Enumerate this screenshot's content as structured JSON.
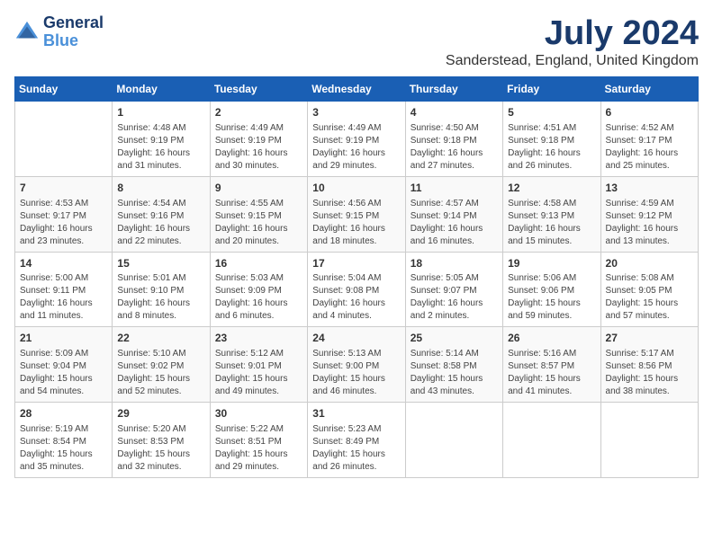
{
  "header": {
    "logo_line1": "General",
    "logo_line2": "Blue",
    "title": "July 2024",
    "subtitle": "Sanderstead, England, United Kingdom"
  },
  "calendar": {
    "headers": [
      "Sunday",
      "Monday",
      "Tuesday",
      "Wednesday",
      "Thursday",
      "Friday",
      "Saturday"
    ],
    "weeks": [
      [
        {
          "day": "",
          "sunrise": "",
          "sunset": "",
          "daylight": ""
        },
        {
          "day": "1",
          "sunrise": "Sunrise: 4:48 AM",
          "sunset": "Sunset: 9:19 PM",
          "daylight": "Daylight: 16 hours and 31 minutes."
        },
        {
          "day": "2",
          "sunrise": "Sunrise: 4:49 AM",
          "sunset": "Sunset: 9:19 PM",
          "daylight": "Daylight: 16 hours and 30 minutes."
        },
        {
          "day": "3",
          "sunrise": "Sunrise: 4:49 AM",
          "sunset": "Sunset: 9:19 PM",
          "daylight": "Daylight: 16 hours and 29 minutes."
        },
        {
          "day": "4",
          "sunrise": "Sunrise: 4:50 AM",
          "sunset": "Sunset: 9:18 PM",
          "daylight": "Daylight: 16 hours and 27 minutes."
        },
        {
          "day": "5",
          "sunrise": "Sunrise: 4:51 AM",
          "sunset": "Sunset: 9:18 PM",
          "daylight": "Daylight: 16 hours and 26 minutes."
        },
        {
          "day": "6",
          "sunrise": "Sunrise: 4:52 AM",
          "sunset": "Sunset: 9:17 PM",
          "daylight": "Daylight: 16 hours and 25 minutes."
        }
      ],
      [
        {
          "day": "7",
          "sunrise": "Sunrise: 4:53 AM",
          "sunset": "Sunset: 9:17 PM",
          "daylight": "Daylight: 16 hours and 23 minutes."
        },
        {
          "day": "8",
          "sunrise": "Sunrise: 4:54 AM",
          "sunset": "Sunset: 9:16 PM",
          "daylight": "Daylight: 16 hours and 22 minutes."
        },
        {
          "day": "9",
          "sunrise": "Sunrise: 4:55 AM",
          "sunset": "Sunset: 9:15 PM",
          "daylight": "Daylight: 16 hours and 20 minutes."
        },
        {
          "day": "10",
          "sunrise": "Sunrise: 4:56 AM",
          "sunset": "Sunset: 9:15 PM",
          "daylight": "Daylight: 16 hours and 18 minutes."
        },
        {
          "day": "11",
          "sunrise": "Sunrise: 4:57 AM",
          "sunset": "Sunset: 9:14 PM",
          "daylight": "Daylight: 16 hours and 16 minutes."
        },
        {
          "day": "12",
          "sunrise": "Sunrise: 4:58 AM",
          "sunset": "Sunset: 9:13 PM",
          "daylight": "Daylight: 16 hours and 15 minutes."
        },
        {
          "day": "13",
          "sunrise": "Sunrise: 4:59 AM",
          "sunset": "Sunset: 9:12 PM",
          "daylight": "Daylight: 16 hours and 13 minutes."
        }
      ],
      [
        {
          "day": "14",
          "sunrise": "Sunrise: 5:00 AM",
          "sunset": "Sunset: 9:11 PM",
          "daylight": "Daylight: 16 hours and 11 minutes."
        },
        {
          "day": "15",
          "sunrise": "Sunrise: 5:01 AM",
          "sunset": "Sunset: 9:10 PM",
          "daylight": "Daylight: 16 hours and 8 minutes."
        },
        {
          "day": "16",
          "sunrise": "Sunrise: 5:03 AM",
          "sunset": "Sunset: 9:09 PM",
          "daylight": "Daylight: 16 hours and 6 minutes."
        },
        {
          "day": "17",
          "sunrise": "Sunrise: 5:04 AM",
          "sunset": "Sunset: 9:08 PM",
          "daylight": "Daylight: 16 hours and 4 minutes."
        },
        {
          "day": "18",
          "sunrise": "Sunrise: 5:05 AM",
          "sunset": "Sunset: 9:07 PM",
          "daylight": "Daylight: 16 hours and 2 minutes."
        },
        {
          "day": "19",
          "sunrise": "Sunrise: 5:06 AM",
          "sunset": "Sunset: 9:06 PM",
          "daylight": "Daylight: 15 hours and 59 minutes."
        },
        {
          "day": "20",
          "sunrise": "Sunrise: 5:08 AM",
          "sunset": "Sunset: 9:05 PM",
          "daylight": "Daylight: 15 hours and 57 minutes."
        }
      ],
      [
        {
          "day": "21",
          "sunrise": "Sunrise: 5:09 AM",
          "sunset": "Sunset: 9:04 PM",
          "daylight": "Daylight: 15 hours and 54 minutes."
        },
        {
          "day": "22",
          "sunrise": "Sunrise: 5:10 AM",
          "sunset": "Sunset: 9:02 PM",
          "daylight": "Daylight: 15 hours and 52 minutes."
        },
        {
          "day": "23",
          "sunrise": "Sunrise: 5:12 AM",
          "sunset": "Sunset: 9:01 PM",
          "daylight": "Daylight: 15 hours and 49 minutes."
        },
        {
          "day": "24",
          "sunrise": "Sunrise: 5:13 AM",
          "sunset": "Sunset: 9:00 PM",
          "daylight": "Daylight: 15 hours and 46 minutes."
        },
        {
          "day": "25",
          "sunrise": "Sunrise: 5:14 AM",
          "sunset": "Sunset: 8:58 PM",
          "daylight": "Daylight: 15 hours and 43 minutes."
        },
        {
          "day": "26",
          "sunrise": "Sunrise: 5:16 AM",
          "sunset": "Sunset: 8:57 PM",
          "daylight": "Daylight: 15 hours and 41 minutes."
        },
        {
          "day": "27",
          "sunrise": "Sunrise: 5:17 AM",
          "sunset": "Sunset: 8:56 PM",
          "daylight": "Daylight: 15 hours and 38 minutes."
        }
      ],
      [
        {
          "day": "28",
          "sunrise": "Sunrise: 5:19 AM",
          "sunset": "Sunset: 8:54 PM",
          "daylight": "Daylight: 15 hours and 35 minutes."
        },
        {
          "day": "29",
          "sunrise": "Sunrise: 5:20 AM",
          "sunset": "Sunset: 8:53 PM",
          "daylight": "Daylight: 15 hours and 32 minutes."
        },
        {
          "day": "30",
          "sunrise": "Sunrise: 5:22 AM",
          "sunset": "Sunset: 8:51 PM",
          "daylight": "Daylight: 15 hours and 29 minutes."
        },
        {
          "day": "31",
          "sunrise": "Sunrise: 5:23 AM",
          "sunset": "Sunset: 8:49 PM",
          "daylight": "Daylight: 15 hours and 26 minutes."
        },
        {
          "day": "",
          "sunrise": "",
          "sunset": "",
          "daylight": ""
        },
        {
          "day": "",
          "sunrise": "",
          "sunset": "",
          "daylight": ""
        },
        {
          "day": "",
          "sunrise": "",
          "sunset": "",
          "daylight": ""
        }
      ]
    ]
  }
}
